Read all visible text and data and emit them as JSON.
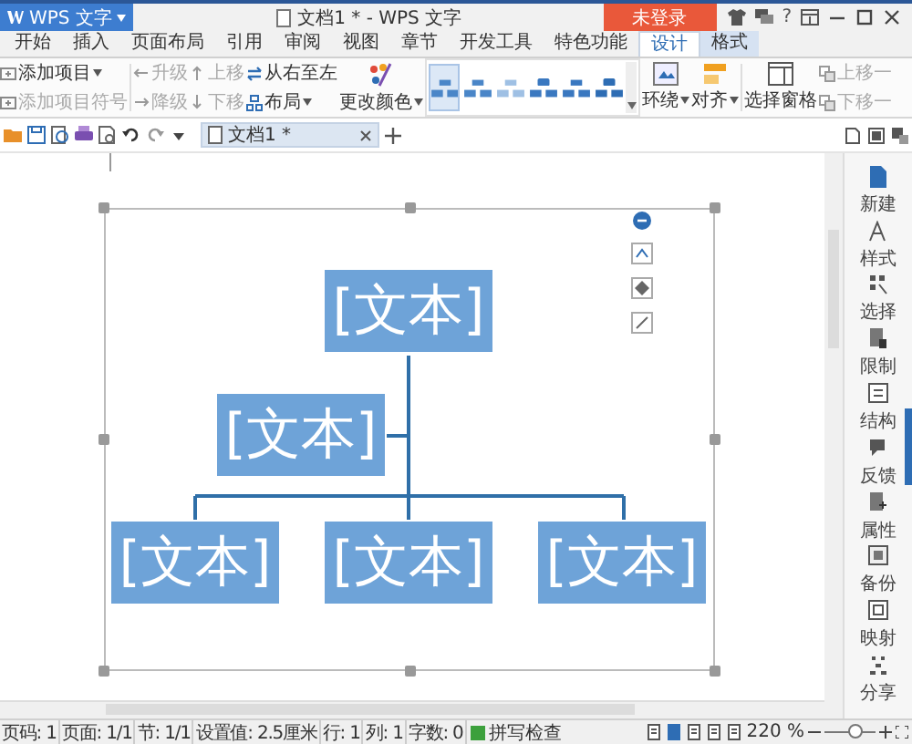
{
  "app_menu": {
    "label": "WPS 文字"
  },
  "window": {
    "title": "文档1 * - WPS 文字"
  },
  "login_button": {
    "label": "未登录"
  },
  "help": {
    "label": "?"
  },
  "tabs": [
    {
      "label": "开始",
      "selected": false
    },
    {
      "label": "插入",
      "selected": false
    },
    {
      "label": "页面布局",
      "selected": false
    },
    {
      "label": "引用",
      "selected": false
    },
    {
      "label": "审阅",
      "selected": false
    },
    {
      "label": "视图",
      "selected": false
    },
    {
      "label": "章节",
      "selected": false
    },
    {
      "label": "开发工具",
      "selected": false
    },
    {
      "label": "特色功能",
      "selected": false
    },
    {
      "label": "设计",
      "selected": true
    },
    {
      "label": "格式",
      "selected": false
    }
  ],
  "ribbon": {
    "item_commands": [
      {
        "label": "添加项目",
        "disabled": false,
        "dropdown": true
      },
      {
        "label": "添加项目符号",
        "disabled": true,
        "dropdown": false
      }
    ],
    "level_commands": [
      {
        "label": "升级",
        "disabled": true,
        "kind": "left"
      },
      {
        "label": "降级",
        "disabled": true,
        "kind": "right"
      }
    ],
    "move_commands": [
      {
        "label": "上移",
        "disabled": true,
        "kind": "up"
      },
      {
        "label": "下移",
        "disabled": true,
        "kind": "down"
      }
    ],
    "direction_commands": [
      {
        "label": "从右至左",
        "disabled": false,
        "dropdown": false,
        "kind": "swap"
      },
      {
        "label": "布局",
        "disabled": false,
        "dropdown": true,
        "kind": "layout"
      }
    ],
    "change_colors": {
      "label": "更改颜色",
      "dropdown": true
    },
    "layouts": [
      {
        "selected": true
      },
      {
        "selected": false
      },
      {
        "selected": false
      },
      {
        "selected": false
      },
      {
        "selected": false
      },
      {
        "selected": false
      }
    ],
    "wrap": {
      "label": "环绕",
      "dropdown": true
    },
    "align": {
      "label": "对齐",
      "dropdown": true
    },
    "selection_pane": {
      "label": "选择窗格"
    },
    "order_commands": [
      {
        "label": "上移一",
        "disabled": true
      },
      {
        "label": "下移一",
        "disabled": true
      }
    ]
  },
  "document_tab": {
    "label": "文档1 *",
    "selected": true
  },
  "diagram": {
    "nodes": [
      {
        "text": "[文本]"
      },
      {
        "text": "[文本]"
      },
      {
        "text": "[文本]"
      },
      {
        "text": "[文本]"
      },
      {
        "text": "[文本]"
      }
    ]
  },
  "sidebar": {
    "items": [
      {
        "label": "新建"
      },
      {
        "label": "样式"
      },
      {
        "label": "选择"
      },
      {
        "label": "限制"
      },
      {
        "label": "结构"
      },
      {
        "label": "反馈"
      },
      {
        "label": "属性"
      },
      {
        "label": "备份"
      },
      {
        "label": "映射"
      },
      {
        "label": "分享"
      }
    ]
  },
  "status_bar": {
    "fields": [
      "页码: 1",
      "页面: 1/1",
      "节: 1/1",
      "设置值: 2.5厘米",
      "行: 1",
      "列: 1",
      "字数: 0"
    ],
    "spell_check": {
      "label": "拼写检查",
      "on": true
    },
    "zoom": {
      "reading": "220 %",
      "level": 0.62
    }
  }
}
